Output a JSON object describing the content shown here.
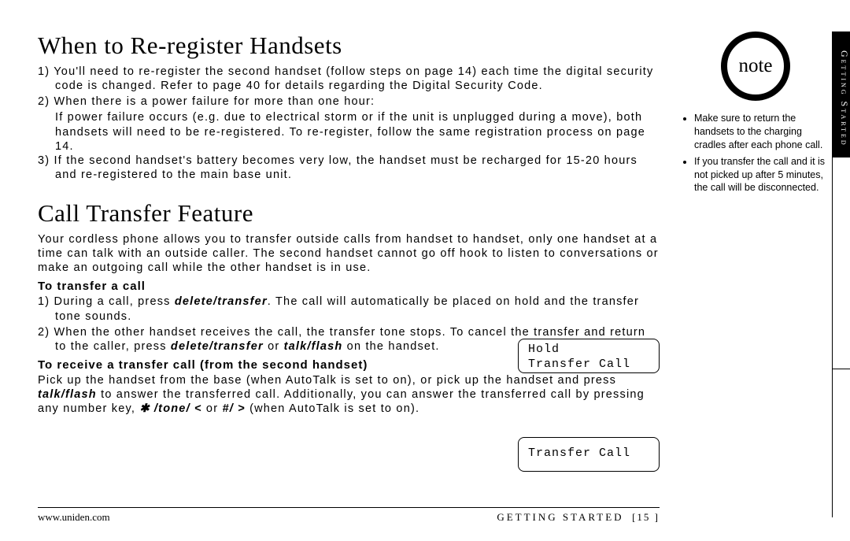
{
  "sideTab": "Getting Started",
  "heading1": "When to Re-register Handsets",
  "h1_item1": "1) You'll need to re-register the second handset (follow steps on page 14) each time the digital security code is changed. Refer to page 40 for details regarding the Digital Security Code.",
  "h1_item2a": "2) When there is a power failure for more than one hour:",
  "h1_item2b": "If power failure occurs (e.g. due to electrical storm or if the unit is unplugged during a move), both handsets will need to be re-registered. To re-register, follow the same registration process on page 14.",
  "h1_item3": "3) If the second handset's battery becomes very low, the handset must be recharged for 15-20 hours and re-registered to the main base unit.",
  "heading2": "Call Transfer Feature",
  "h2_intro": "Your cordless phone allows you to transfer outside calls from handset to handset, only one handset at a time can talk with an outside caller. The second handset cannot go off hook to listen to conversations or make an outgoing call while the other handset is in use.",
  "sub1": "To transfer a call",
  "sub1_item1_a": "1) During a call, press ",
  "sub1_item1_b": ". The call will automatically be placed on hold and the transfer tone sounds.",
  "sub1_item2_a": "2) When the other handset receives the call, the transfer tone stops. To cancel the transfer and return to the caller, press ",
  "sub1_item2_b": " or ",
  "sub1_item2_c": " on the handset.",
  "sub2": "To receive a transfer call (from the second handset)",
  "sub2_body_a": "Pick up the handset from the base (when AutoTalk is set to on), or pick up the handset and press ",
  "sub2_body_b": " to answer the transferred call. Additionally, you can answer the transferred call by pressing any number key, ",
  "sub2_body_c": " or ",
  "sub2_body_d": " (when AutoTalk is set to on).",
  "kw_delete_transfer": "delete/transfer",
  "kw_talk_flash": "talk/flash",
  "kw_star_tone": "✱ /tone/ <",
  "kw_hash": "#/ >",
  "lcd1_line1": "Hold",
  "lcd1_line2": "Transfer Call",
  "lcd2_line1": "Transfer Call",
  "note_label": "note",
  "note1": "Make sure to return the handsets to the charging cradles after each phone call.",
  "note2": "If you transfer the call and it is not picked up after 5 minutes, the call will be disconnected.",
  "footer_left": "www.uniden.com",
  "footer_right_label": "GETTING STARTED",
  "footer_page": "[15 ]"
}
